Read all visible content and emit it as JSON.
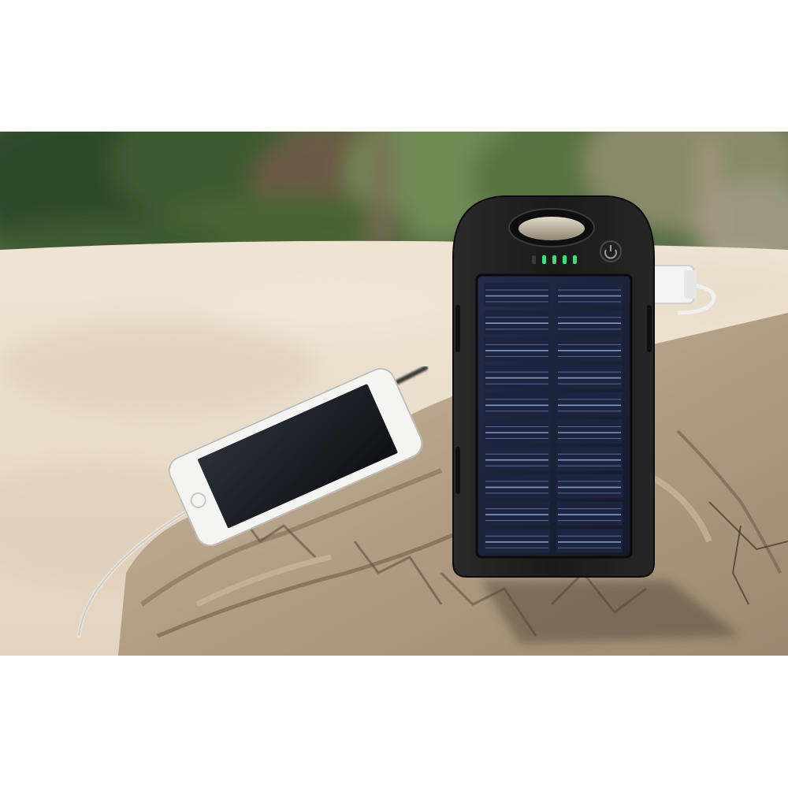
{
  "photo": {
    "colors": {
      "page_background": "#ffffff",
      "foliage_dark": "#2f4a2a",
      "foliage_light": "#6f8a55",
      "sand": "#e9dccb",
      "wood": "#b9a68c",
      "wood_shadow": "#6e5f4c",
      "device_body": "#1b1b1b",
      "solar_cell": "#1f2a44",
      "solar_line": "#8ea6d6",
      "indicator_led": "#38e07a",
      "phone_body": "#f4f4f2",
      "phone_screen": "#16181c",
      "usb_plug": "#f3f3f3"
    },
    "objects": [
      "solar-power-bank",
      "smartphone",
      "usb-cable",
      "driftwood-log",
      "sandy-beach",
      "blurred-trees"
    ],
    "led_count": 4,
    "solar_rows": 10,
    "solar_columns": 2
  }
}
